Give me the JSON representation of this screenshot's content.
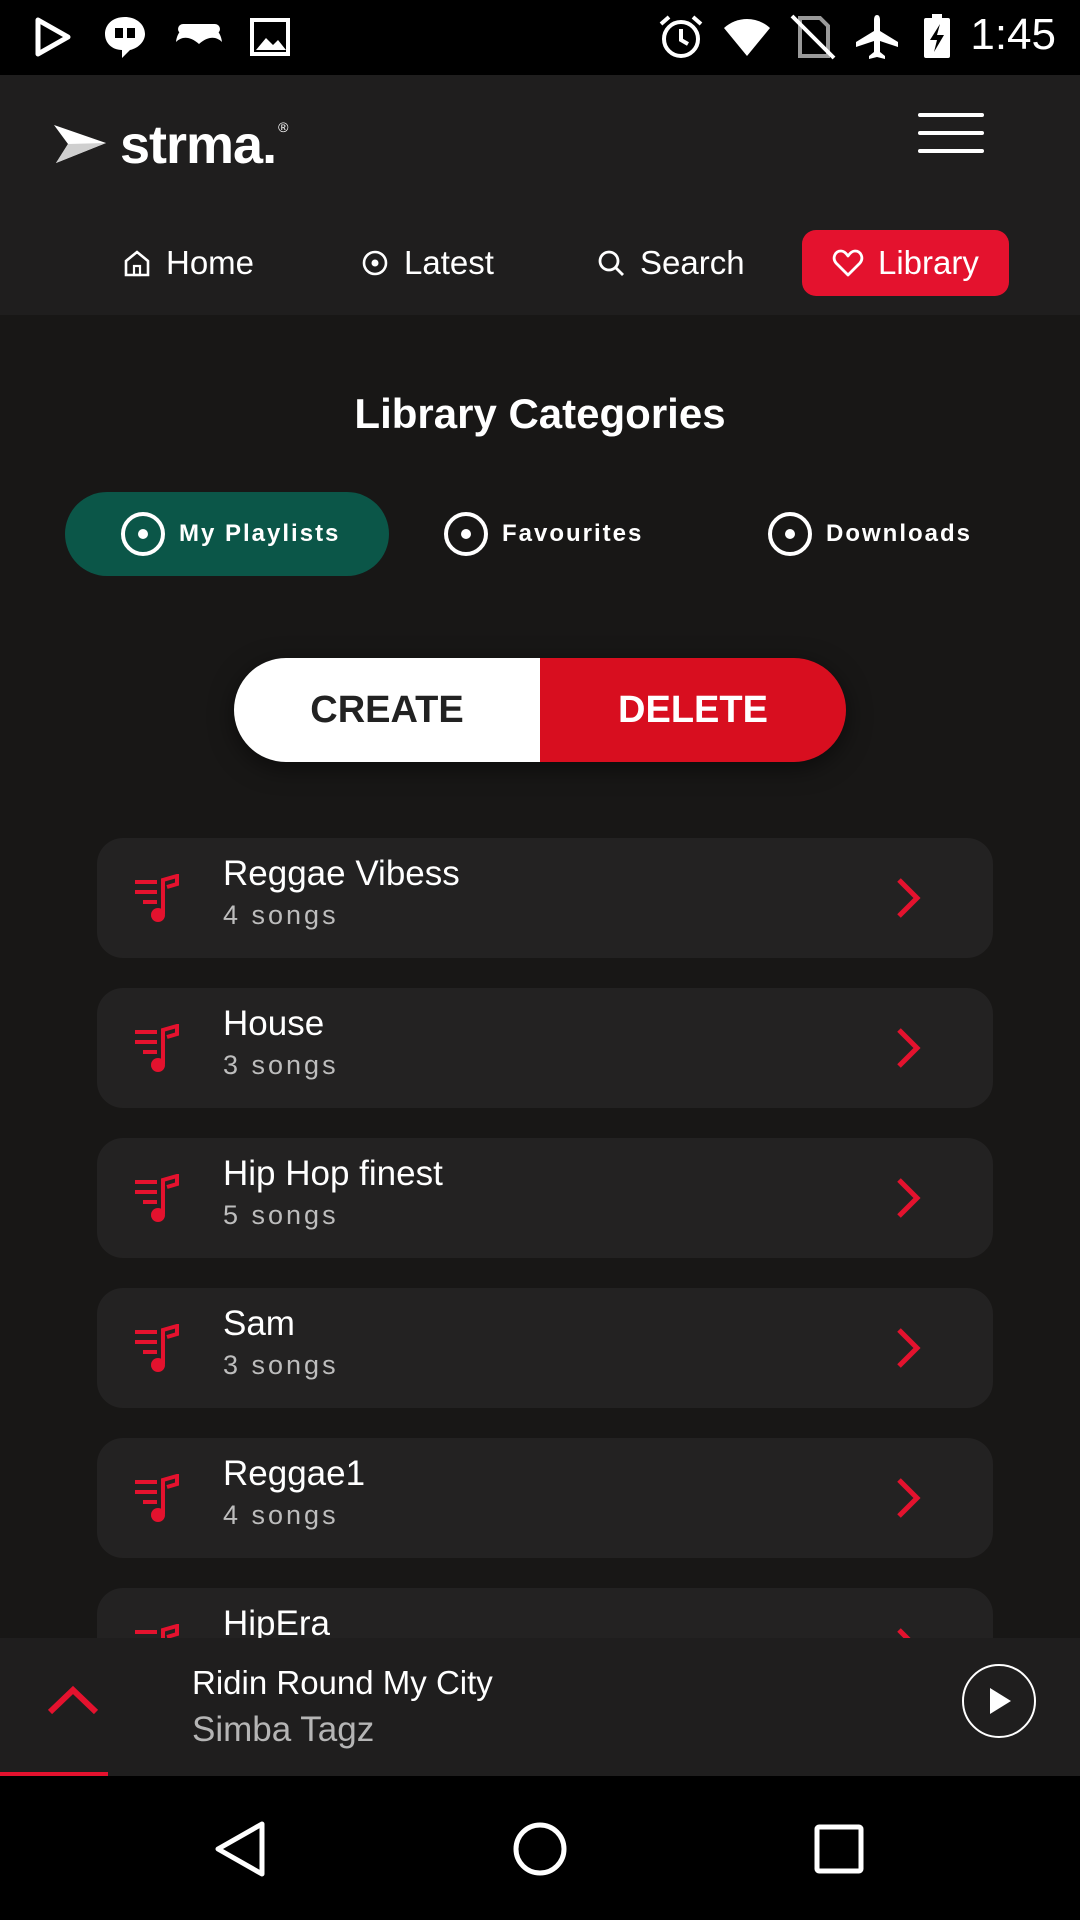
{
  "status_bar": {
    "time": "1:45",
    "icons": [
      "play-store-icon",
      "quote-icon",
      "mustache-icon",
      "image-icon",
      "alarm-icon",
      "wifi-icon",
      "no-sim-icon",
      "airplane-icon",
      "battery-charging-icon"
    ]
  },
  "app": {
    "name": "strma.",
    "registered_mark": "®"
  },
  "nav": {
    "items": [
      {
        "label": "Home",
        "icon": "home-icon"
      },
      {
        "label": "Latest",
        "icon": "latest-icon"
      },
      {
        "label": "Search",
        "icon": "search-icon"
      },
      {
        "label": "Library",
        "icon": "heart-icon",
        "active": true
      }
    ]
  },
  "page": {
    "title": "Library Categories"
  },
  "categories": [
    {
      "label": "My Playlists",
      "active": true
    },
    {
      "label": "Favourites"
    },
    {
      "label": "Downloads"
    }
  ],
  "actions": {
    "create_label": "CREATE",
    "delete_label": "DELETE"
  },
  "playlists": [
    {
      "name": "Reggae Vibess",
      "count": "4 songs"
    },
    {
      "name": "House",
      "count": "3 songs"
    },
    {
      "name": "Hip Hop finest",
      "count": "5 songs"
    },
    {
      "name": "Sam",
      "count": "3 songs"
    },
    {
      "name": "Reggae1",
      "count": "4 songs"
    },
    {
      "name": "HipEra",
      "count": ""
    }
  ],
  "player": {
    "title": "Ridin Round My City",
    "artist": "Simba Tagz",
    "progress": 0.1
  },
  "colors": {
    "accent": "#e4122e",
    "active_category": "#0b5648",
    "background": "#181716",
    "card": "#232222"
  }
}
